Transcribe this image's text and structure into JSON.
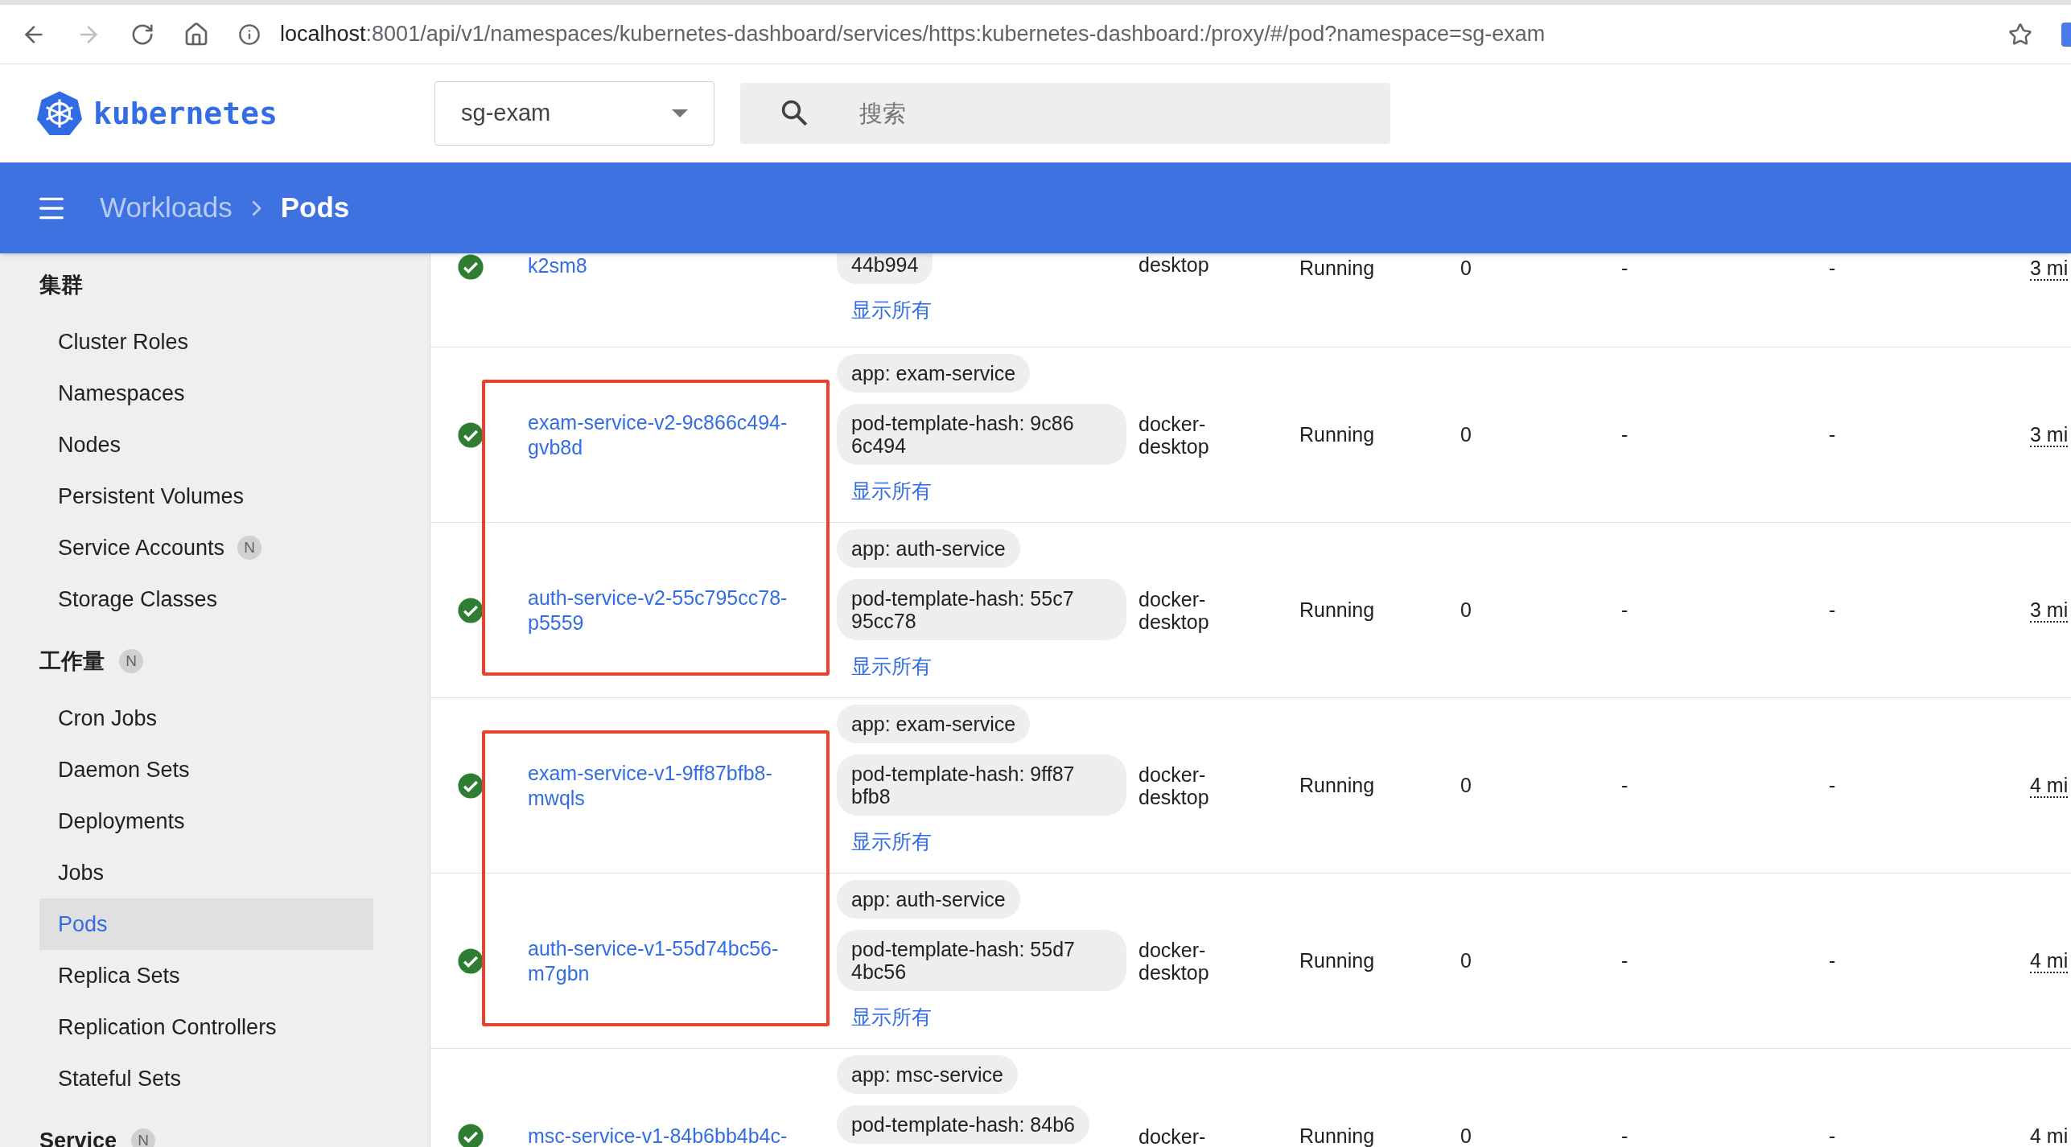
{
  "browser": {
    "url_host": "localhost",
    "url_path": ":8001/api/v1/namespaces/kubernetes-dashboard/services/https:kubernetes-dashboard:/proxy/#/pod?namespace=sg-exam"
  },
  "header": {
    "logo_text": "kubernetes",
    "namespace": "sg-exam",
    "search_placeholder": "搜索"
  },
  "breadcrumb": [
    {
      "label": "Workloads",
      "selected": false
    },
    {
      "label": "Pods",
      "selected": true
    }
  ],
  "sidebar": {
    "sections": [
      {
        "title": "集群",
        "items": [
          {
            "label": "Cluster Roles",
            "selected": false
          },
          {
            "label": "Namespaces",
            "selected": false
          },
          {
            "label": "Nodes",
            "selected": false
          },
          {
            "label": "Persistent Volumes",
            "selected": false
          },
          {
            "label": "Service Accounts",
            "badge": "N",
            "selected": false
          },
          {
            "label": "Storage Classes",
            "selected": false
          }
        ]
      },
      {
        "title": "工作量",
        "badge": "N",
        "items": [
          {
            "label": "Cron Jobs",
            "selected": false
          },
          {
            "label": "Daemon Sets",
            "selected": false
          },
          {
            "label": "Deployments",
            "selected": false
          },
          {
            "label": "Jobs",
            "selected": false
          },
          {
            "label": "Pods",
            "selected": true
          },
          {
            "label": "Replica Sets",
            "selected": false
          },
          {
            "label": "Replication Controllers",
            "selected": false
          },
          {
            "label": "Stateful Sets",
            "selected": false
          }
        ]
      },
      {
        "title": "Service",
        "badge": "N"
      }
    ]
  },
  "table": {
    "row_groups": [
      {
        "boxed": false,
        "rows": [
          {
            "kind": "partial",
            "name": "k2sm8",
            "labels": [
              "44b994"
            ],
            "show_all": "显示所有",
            "node": "desktop",
            "status": "Running",
            "restarts": "0",
            "column_7": "-",
            "column_8": "-",
            "age": "3 mi"
          }
        ]
      },
      {
        "boxed": true,
        "rows": [
          {
            "kind": "full",
            "name": "exam-service-v2-9c866c494-gvb8d",
            "labels": [
              "app: exam-service",
              "pod-template-hash: 9c86 6c494"
            ],
            "show_all": "显示所有",
            "node": "docker-desktop",
            "status": "Running",
            "restarts": "0",
            "column_7": "-",
            "column_8": "-",
            "age": "3 mi"
          },
          {
            "kind": "full",
            "name": "auth-service-v2-55c795cc78-p5559",
            "labels": [
              "app: auth-service",
              "pod-template-hash: 55c7 95cc78"
            ],
            "show_all": "显示所有",
            "node": "docker-desktop",
            "status": "Running",
            "restarts": "0",
            "column_7": "-",
            "column_8": "-",
            "age": "3 mi"
          }
        ]
      },
      {
        "boxed": true,
        "rows": [
          {
            "kind": "full",
            "name": "exam-service-v1-9ff87bfb8-mwqls",
            "labels": [
              "app: exam-service",
              "pod-template-hash: 9ff87 bfb8"
            ],
            "show_all": "显示所有",
            "node": "docker-desktop",
            "status": "Running",
            "restarts": "0",
            "column_7": "-",
            "column_8": "-",
            "age": "4 mi"
          },
          {
            "kind": "full",
            "name": "auth-service-v1-55d74bc56-m7gbn",
            "labels": [
              "app: auth-service",
              "pod-template-hash: 55d7 4bc56"
            ],
            "show_all": "显示所有",
            "node": "docker-desktop",
            "status": "Running",
            "restarts": "0",
            "column_7": "-",
            "column_8": "-",
            "age": "4 mi"
          }
        ]
      },
      {
        "boxed": false,
        "rows": [
          {
            "kind": "full",
            "name": "msc-service-v1-84b6bb4b4c-",
            "labels": [
              "app: msc-service",
              "pod-template-hash: 84b6"
            ],
            "node": "docker-",
            "status": "Running",
            "restarts": "0",
            "column_7": "-",
            "column_8": "-",
            "age": "4 mi"
          }
        ]
      }
    ]
  }
}
